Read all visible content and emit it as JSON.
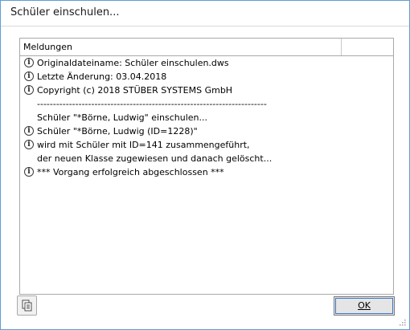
{
  "window": {
    "title": "Schüler einschulen..."
  },
  "panel": {
    "header": "Meldungen",
    "rows": [
      {
        "icon": "info",
        "text": "Originaldateiname: Schüler einschulen.dws"
      },
      {
        "icon": "info",
        "text": "Letzte Änderung: 03.04.2018"
      },
      {
        "icon": "info",
        "text": "Copyright (c) 2018 STÜBER SYSTEMS GmbH"
      },
      {
        "icon": "",
        "text": "------------------------------------------------------------------------"
      },
      {
        "icon": "",
        "text": "Schüler \"*Börne, Ludwig\" einschulen..."
      },
      {
        "icon": "info",
        "text": "Schüler \"*Börne, Ludwig (ID=1228)\""
      },
      {
        "icon": "info",
        "text": "wird mit Schüler mit ID=141 zusammengeführt,"
      },
      {
        "icon": "",
        "text": "der neuen Klasse zugewiesen und danach gelöscht..."
      },
      {
        "icon": "info",
        "text": "*** Vorgang erfolgreich abgeschlossen ***"
      }
    ]
  },
  "buttons": {
    "ok": "OK"
  },
  "icons": {
    "copy": "copy-icon",
    "info": "info-icon"
  }
}
